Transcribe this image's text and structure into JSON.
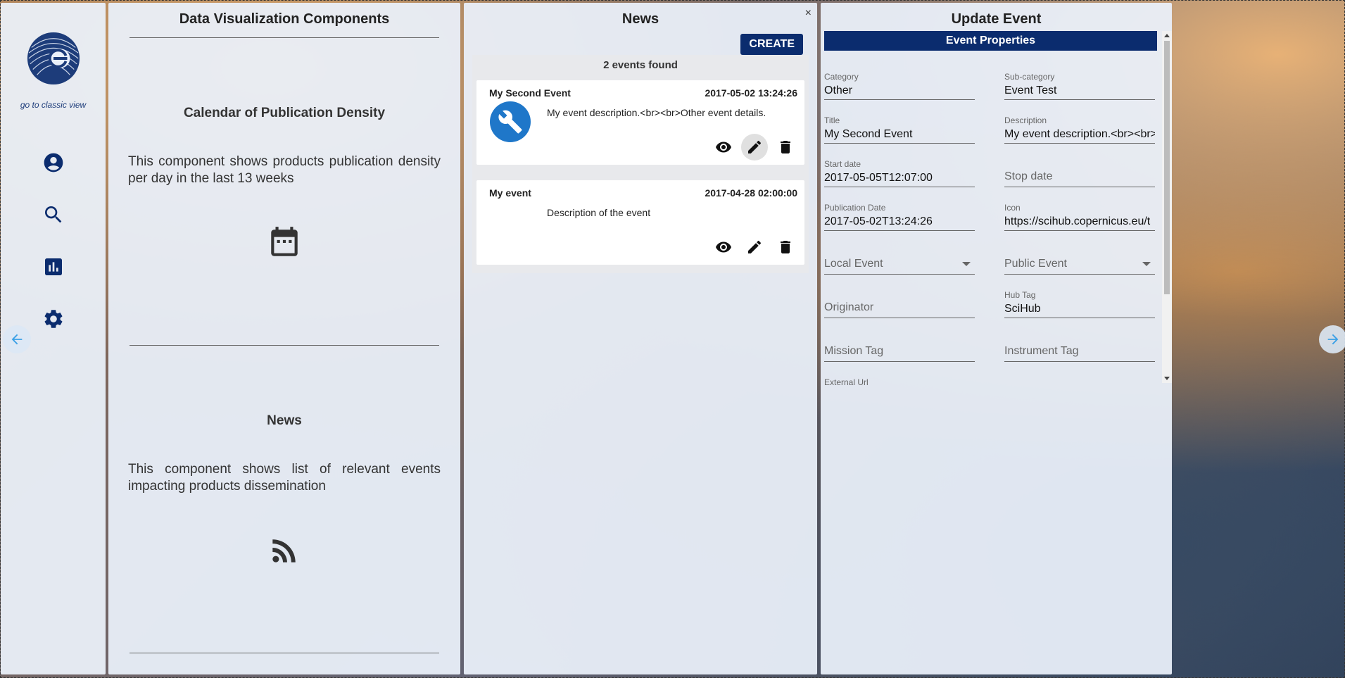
{
  "sidebar": {
    "classic_link": "go to classic view",
    "icons": [
      "account-icon",
      "search-icon",
      "chart-icon",
      "settings-icon"
    ]
  },
  "dv_panel": {
    "title": "Data Visualization Components",
    "sections": [
      {
        "title": "Calendar of Publication Density",
        "description": "This component shows products publication density per day in the last 13 weeks",
        "icon": "calendar-icon"
      },
      {
        "title": "News",
        "description": "This component shows list of relevant events impacting products dissemination",
        "icon": "rss-icon"
      }
    ]
  },
  "news_panel": {
    "title": "News",
    "close": "×",
    "create_label": "CREATE",
    "count_label": "2 events found",
    "events": [
      {
        "title": "My Second Event",
        "date": "2017-05-02 13:24:26",
        "description": "My event description.<br><br>Other event details."
      },
      {
        "title": "My event",
        "date": "2017-04-28 02:00:00",
        "description": "Description of the event"
      }
    ]
  },
  "update_panel": {
    "title": "Update Event",
    "section_header": "Event Properties",
    "fields": {
      "category": {
        "label": "Category",
        "value": "Other"
      },
      "subcategory": {
        "label": "Sub-category",
        "value": "Event Test"
      },
      "title": {
        "label": "Title",
        "value": "My Second Event"
      },
      "description": {
        "label": "Description",
        "value": "My event description.<br><br>Other event details."
      },
      "start_date": {
        "label": "Start date",
        "value": "2017-05-05T12:07:00"
      },
      "stop_date": {
        "placeholder": "Stop date"
      },
      "publication_date": {
        "label": "Publication Date",
        "value": "2017-05-02T13:24:26"
      },
      "icon": {
        "label": "Icon",
        "value": "https://scihub.copernicus.eu/t"
      },
      "local_event": {
        "placeholder": "Local Event"
      },
      "public_event": {
        "placeholder": "Public Event"
      },
      "originator": {
        "placeholder": "Originator"
      },
      "hub_tag": {
        "label": "Hub Tag",
        "value": "SciHub"
      },
      "mission_tag": {
        "placeholder": "Mission Tag"
      },
      "instrument_tag": {
        "placeholder": "Instrument Tag"
      },
      "external_url": {
        "label": "External Url"
      }
    }
  },
  "colors": {
    "primary": "#0b2c6e",
    "accent": "#3aa0e6",
    "avatar": "#1f77c9"
  }
}
